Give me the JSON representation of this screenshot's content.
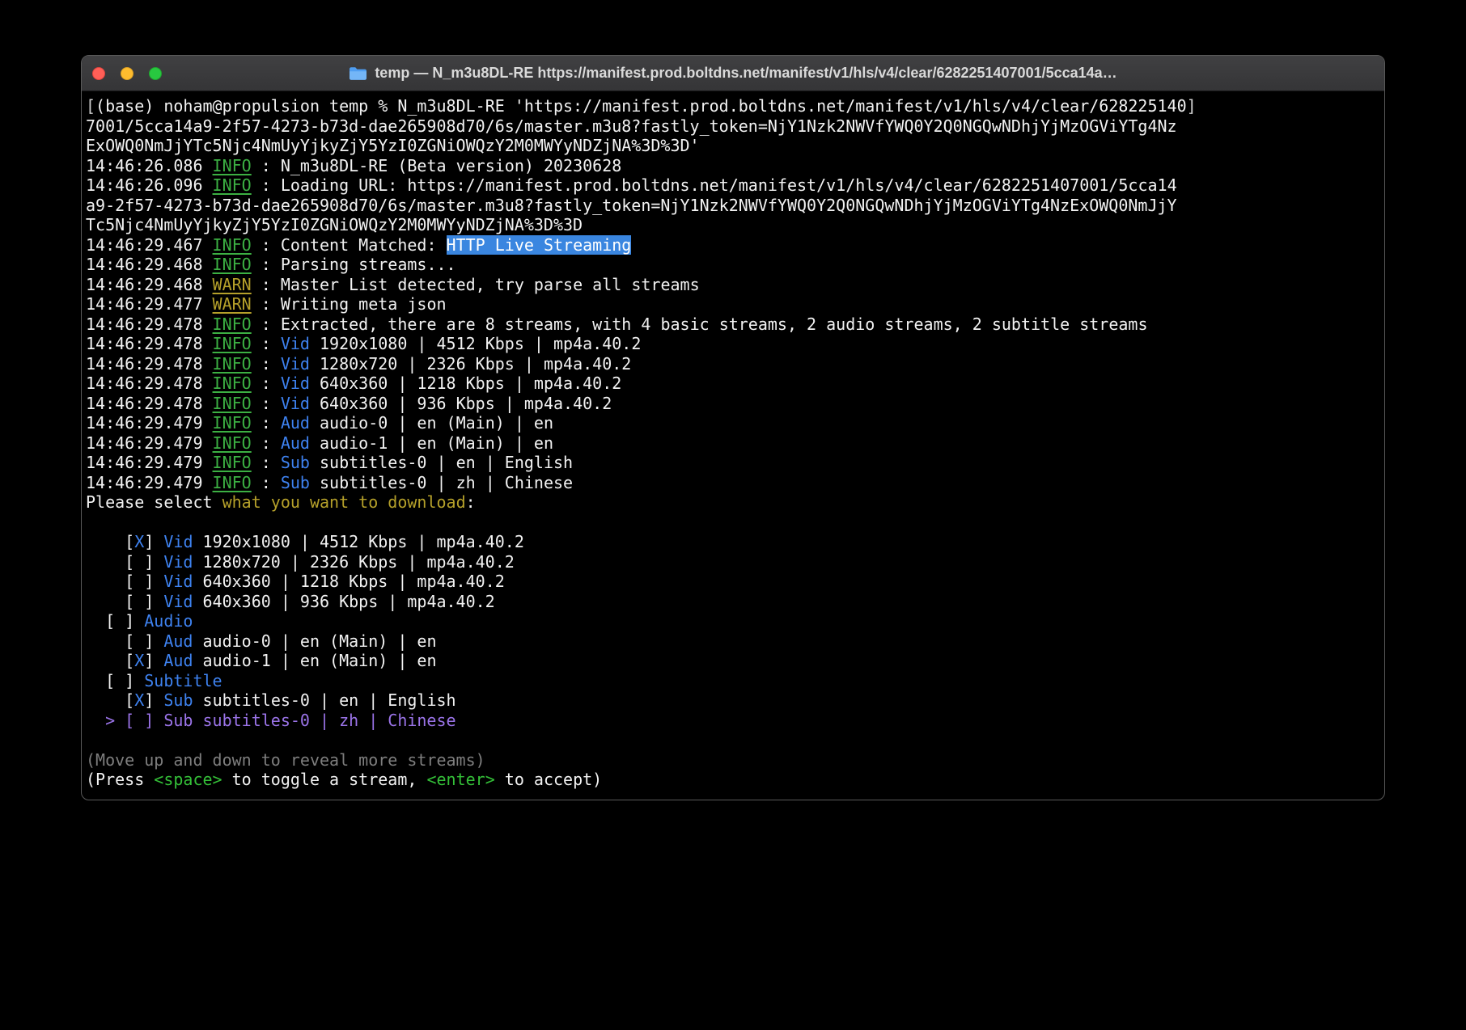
{
  "window": {
    "title": "temp — N_m3u8DL-RE https://manifest.prod.boltdns.net/manifest/v1/hls/v4/clear/6282251407001/5cca14a…",
    "traffic_lights": [
      {
        "name": "close",
        "color": "#ff5f57"
      },
      {
        "name": "minimize",
        "color": "#febc2e"
      },
      {
        "name": "zoom",
        "color": "#28c840"
      }
    ]
  },
  "colors": {
    "terminal_bg": "#000000",
    "titlebar_text": "#d9d9d9",
    "text": "#f2f2f2",
    "info_green": "#3cb043",
    "warn_yellow": "#b5a02a",
    "accent_blue": "#3e82f0",
    "highlight_bg": "#3a86e0",
    "selected_purple": "#9b74e9",
    "hint_gray": "#7e7e7e",
    "key_green": "#34c038"
  },
  "terminal": {
    "lines": [
      {
        "name": "prompt-command-line-1",
        "segs": [
          [
            "mark",
            "["
          ],
          [
            "plain",
            "(base) noham@propulsion temp % N_m3u8DL-RE 'https://manifest.prod.boltdns.net/manifest/v1/hls/v4/clear/628225140"
          ],
          [
            "mark",
            "]"
          ]
        ]
      },
      {
        "name": "prompt-command-line-2",
        "segs": [
          [
            "plain",
            "7001/5cca14a9-2f57-4273-b73d-dae265908d70/6s/master.m3u8?fastly_token=NjY1Nzk2NWVfYWQ0Y2Q0NGQwNDhjYjMzOGViYTg4Nz"
          ]
        ]
      },
      {
        "name": "prompt-command-line-3",
        "segs": [
          [
            "plain",
            "ExOWQ0NmJjYTc5Njc4NmUyYjkyZjY5YzI0ZGNiOWQzY2M0MWYyNDZjNA%3D%3D'"
          ]
        ]
      },
      {
        "name": "log-version",
        "segs": [
          [
            "plain",
            "14:46:26.086 "
          ],
          [
            "info",
            "INFO"
          ],
          [
            "plain",
            " : N_m3u8DL-RE (Beta version) 20230628"
          ]
        ]
      },
      {
        "name": "log-loading-url-1",
        "segs": [
          [
            "plain",
            "14:46:26.096 "
          ],
          [
            "info",
            "INFO"
          ],
          [
            "plain",
            " : Loading URL: https://manifest.prod.boltdns.net/manifest/v1/hls/v4/clear/6282251407001/5cca14"
          ]
        ]
      },
      {
        "name": "log-loading-url-2",
        "segs": [
          [
            "plain",
            "a9-2f57-4273-b73d-dae265908d70/6s/master.m3u8?fastly_token=NjY1Nzk2NWVfYWQ0Y2Q0NGQwNDhjYjMzOGViYTg4NzExOWQ0NmJjY"
          ]
        ]
      },
      {
        "name": "log-loading-url-3",
        "segs": [
          [
            "plain",
            "Tc5Njc4NmUyYjkyZjY5YzI0ZGNiOWQzY2M0MWYyNDZjNA%3D%3D"
          ]
        ]
      },
      {
        "name": "log-content-matched",
        "segs": [
          [
            "plain",
            "14:46:29.467 "
          ],
          [
            "info",
            "INFO"
          ],
          [
            "plain",
            " : Content Matched: "
          ],
          [
            "hl",
            "HTTP Live Streaming"
          ]
        ]
      },
      {
        "name": "log-parsing-streams",
        "segs": [
          [
            "plain",
            "14:46:29.468 "
          ],
          [
            "info",
            "INFO"
          ],
          [
            "plain",
            " : Parsing streams..."
          ]
        ]
      },
      {
        "name": "log-master-list",
        "segs": [
          [
            "plain",
            "14:46:29.468 "
          ],
          [
            "warn",
            "WARN"
          ],
          [
            "plain",
            " : Master List detected, try parse all streams"
          ]
        ]
      },
      {
        "name": "log-writing-meta",
        "segs": [
          [
            "plain",
            "14:46:29.477 "
          ],
          [
            "warn",
            "WARN"
          ],
          [
            "plain",
            " : Writing meta json"
          ]
        ]
      },
      {
        "name": "log-extracted-summary",
        "segs": [
          [
            "plain",
            "14:46:29.478 "
          ],
          [
            "info",
            "INFO"
          ],
          [
            "plain",
            " : Extracted, there are 8 streams, with 4 basic streams, 2 audio streams, 2 subtitle streams"
          ]
        ]
      },
      {
        "name": "log-stream-vid-1080",
        "segs": [
          [
            "plain",
            "14:46:29.478 "
          ],
          [
            "info",
            "INFO"
          ],
          [
            "plain",
            " : "
          ],
          [
            "blue",
            "Vid"
          ],
          [
            "plain",
            " 1920x1080 | 4512 Kbps | mp4a.40.2"
          ]
        ]
      },
      {
        "name": "log-stream-vid-720",
        "segs": [
          [
            "plain",
            "14:46:29.478 "
          ],
          [
            "info",
            "INFO"
          ],
          [
            "plain",
            " : "
          ],
          [
            "blue",
            "Vid"
          ],
          [
            "plain",
            " 1280x720 | 2326 Kbps | mp4a.40.2"
          ]
        ]
      },
      {
        "name": "log-stream-vid-360a",
        "segs": [
          [
            "plain",
            "14:46:29.478 "
          ],
          [
            "info",
            "INFO"
          ],
          [
            "plain",
            " : "
          ],
          [
            "blue",
            "Vid"
          ],
          [
            "plain",
            " 640x360 | 1218 Kbps | mp4a.40.2"
          ]
        ]
      },
      {
        "name": "log-stream-vid-360b",
        "segs": [
          [
            "plain",
            "14:46:29.478 "
          ],
          [
            "info",
            "INFO"
          ],
          [
            "plain",
            " : "
          ],
          [
            "blue",
            "Vid"
          ],
          [
            "plain",
            " 640x360 | 936 Kbps | mp4a.40.2"
          ]
        ]
      },
      {
        "name": "log-stream-aud-0",
        "segs": [
          [
            "plain",
            "14:46:29.479 "
          ],
          [
            "info",
            "INFO"
          ],
          [
            "plain",
            " : "
          ],
          [
            "blue",
            "Aud"
          ],
          [
            "plain",
            " audio-0 | en (Main) | en"
          ]
        ]
      },
      {
        "name": "log-stream-aud-1",
        "segs": [
          [
            "plain",
            "14:46:29.479 "
          ],
          [
            "info",
            "INFO"
          ],
          [
            "plain",
            " : "
          ],
          [
            "blue",
            "Aud"
          ],
          [
            "plain",
            " audio-1 | en (Main) | en"
          ]
        ]
      },
      {
        "name": "log-stream-sub-en",
        "segs": [
          [
            "plain",
            "14:46:29.479 "
          ],
          [
            "info",
            "INFO"
          ],
          [
            "plain",
            " : "
          ],
          [
            "blue",
            "Sub"
          ],
          [
            "plain",
            " subtitles-0 | en | English"
          ]
        ]
      },
      {
        "name": "log-stream-sub-zh",
        "segs": [
          [
            "plain",
            "14:46:29.479 "
          ],
          [
            "info",
            "INFO"
          ],
          [
            "plain",
            " : "
          ],
          [
            "blue",
            "Sub"
          ],
          [
            "plain",
            " subtitles-0 | zh | Chinese"
          ]
        ]
      },
      {
        "name": "select-prompt",
        "segs": [
          [
            "plain",
            "Please select "
          ],
          [
            "yellow",
            "what you want to download"
          ],
          [
            "plain",
            ":"
          ]
        ]
      },
      {
        "name": "blank-line",
        "segs": []
      },
      {
        "name": "stream-option-vid-1080",
        "segs": [
          [
            "plain",
            "    ["
          ],
          [
            "blue",
            "X"
          ],
          [
            "plain",
            "] "
          ],
          [
            "blue",
            "Vid"
          ],
          [
            "plain",
            " 1920x1080 | 4512 Kbps | mp4a.40.2"
          ]
        ]
      },
      {
        "name": "stream-option-vid-720",
        "segs": [
          [
            "plain",
            "    [ ] "
          ],
          [
            "blue",
            "Vid"
          ],
          [
            "plain",
            " 1280x720 | 2326 Kbps | mp4a.40.2"
          ]
        ]
      },
      {
        "name": "stream-option-vid-360a",
        "segs": [
          [
            "plain",
            "    [ ] "
          ],
          [
            "blue",
            "Vid"
          ],
          [
            "plain",
            " 640x360 | 1218 Kbps | mp4a.40.2"
          ]
        ]
      },
      {
        "name": "stream-option-vid-360b",
        "segs": [
          [
            "plain",
            "    [ ] "
          ],
          [
            "blue",
            "Vid"
          ],
          [
            "plain",
            " 640x360 | 936 Kbps | mp4a.40.2"
          ]
        ]
      },
      {
        "name": "stream-group-audio",
        "segs": [
          [
            "plain",
            "  [ ] "
          ],
          [
            "blue",
            "Audio"
          ]
        ]
      },
      {
        "name": "stream-option-aud-0",
        "segs": [
          [
            "plain",
            "    [ ] "
          ],
          [
            "blue",
            "Aud"
          ],
          [
            "plain",
            " audio-0 | en (Main) | en"
          ]
        ]
      },
      {
        "name": "stream-option-aud-1",
        "segs": [
          [
            "plain",
            "    ["
          ],
          [
            "blue",
            "X"
          ],
          [
            "plain",
            "] "
          ],
          [
            "blue",
            "Aud"
          ],
          [
            "plain",
            " audio-1 | en (Main) | en"
          ]
        ]
      },
      {
        "name": "stream-group-subtitle",
        "segs": [
          [
            "plain",
            "  [ ] "
          ],
          [
            "blue",
            "Subtitle"
          ]
        ]
      },
      {
        "name": "stream-option-sub-en",
        "segs": [
          [
            "plain",
            "    ["
          ],
          [
            "blue",
            "X"
          ],
          [
            "plain",
            "] "
          ],
          [
            "blue",
            "Sub"
          ],
          [
            "plain",
            " subtitles-0 | en | English"
          ]
        ]
      },
      {
        "name": "stream-option-sub-zh-cursor",
        "segs": [
          [
            "purple",
            "  > [ ] Sub subtitles-0 | zh | Chinese"
          ]
        ]
      },
      {
        "name": "blank-line",
        "segs": []
      },
      {
        "name": "hint-scroll",
        "segs": [
          [
            "gray",
            "(Move up and down to reveal more streams)"
          ]
        ]
      },
      {
        "name": "hint-keys",
        "segs": [
          [
            "plain",
            "(Press "
          ],
          [
            "green",
            "<space>"
          ],
          [
            "plain",
            " to toggle a stream, "
          ],
          [
            "green",
            "<enter>"
          ],
          [
            "plain",
            " to accept)"
          ]
        ]
      }
    ]
  }
}
